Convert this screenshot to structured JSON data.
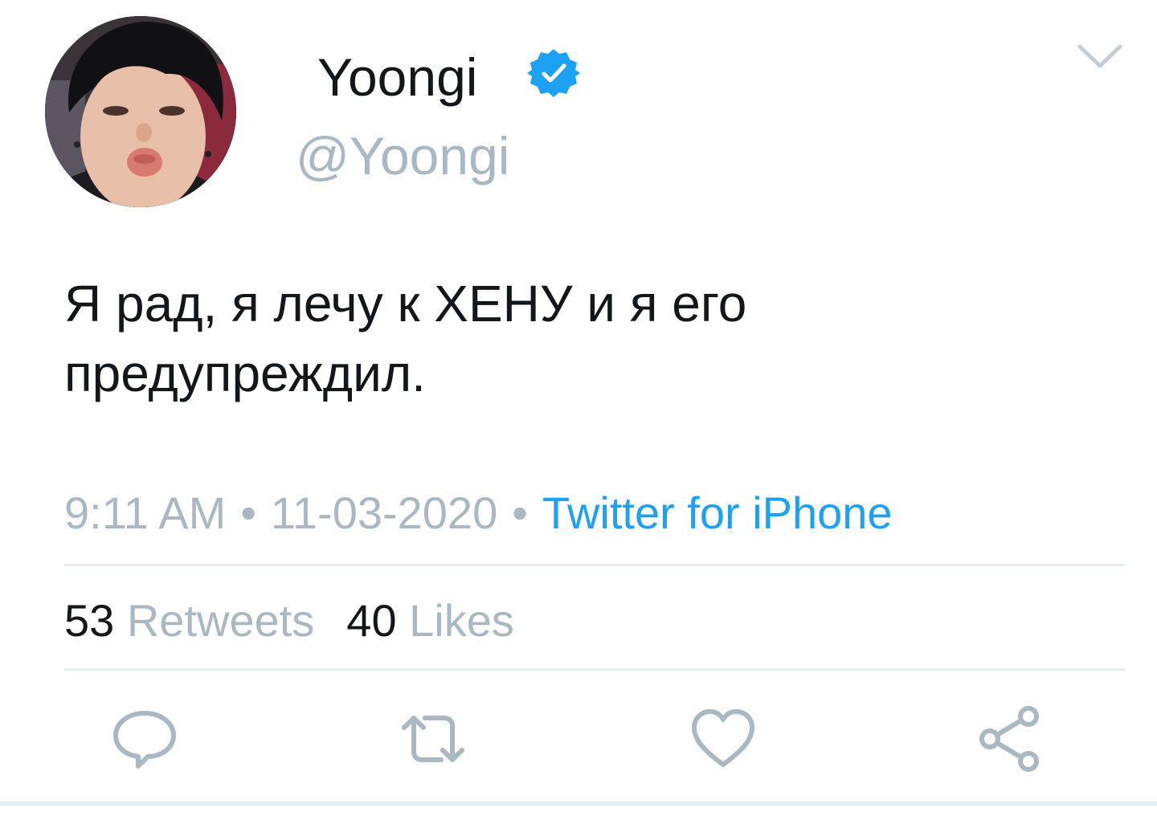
{
  "tweet": {
    "display_name": "Yoongi",
    "handle": "@Yoongi",
    "verified": true,
    "text": "Я рад, я лечу к ХЕНУ и я его предупреждил.",
    "meta": {
      "time": "9:11 AM",
      "date": "11-03-2020",
      "source": "Twitter for iPhone",
      "separator": "•"
    },
    "stats": {
      "retweets_count": "53",
      "retweets_label": "Retweets",
      "likes_count": "40",
      "likes_label": "Likes"
    }
  },
  "icons": {
    "verified": "verified-badge-icon",
    "menu": "chevron-down-icon",
    "reply": "reply-icon",
    "retweet": "retweet-icon",
    "like": "heart-icon",
    "share": "share-icon"
  },
  "colors": {
    "text": "#14171a",
    "muted": "#aab8c2",
    "link": "#1da1f2",
    "verified": "#1da1f2",
    "divider": "#e6ecf0"
  }
}
